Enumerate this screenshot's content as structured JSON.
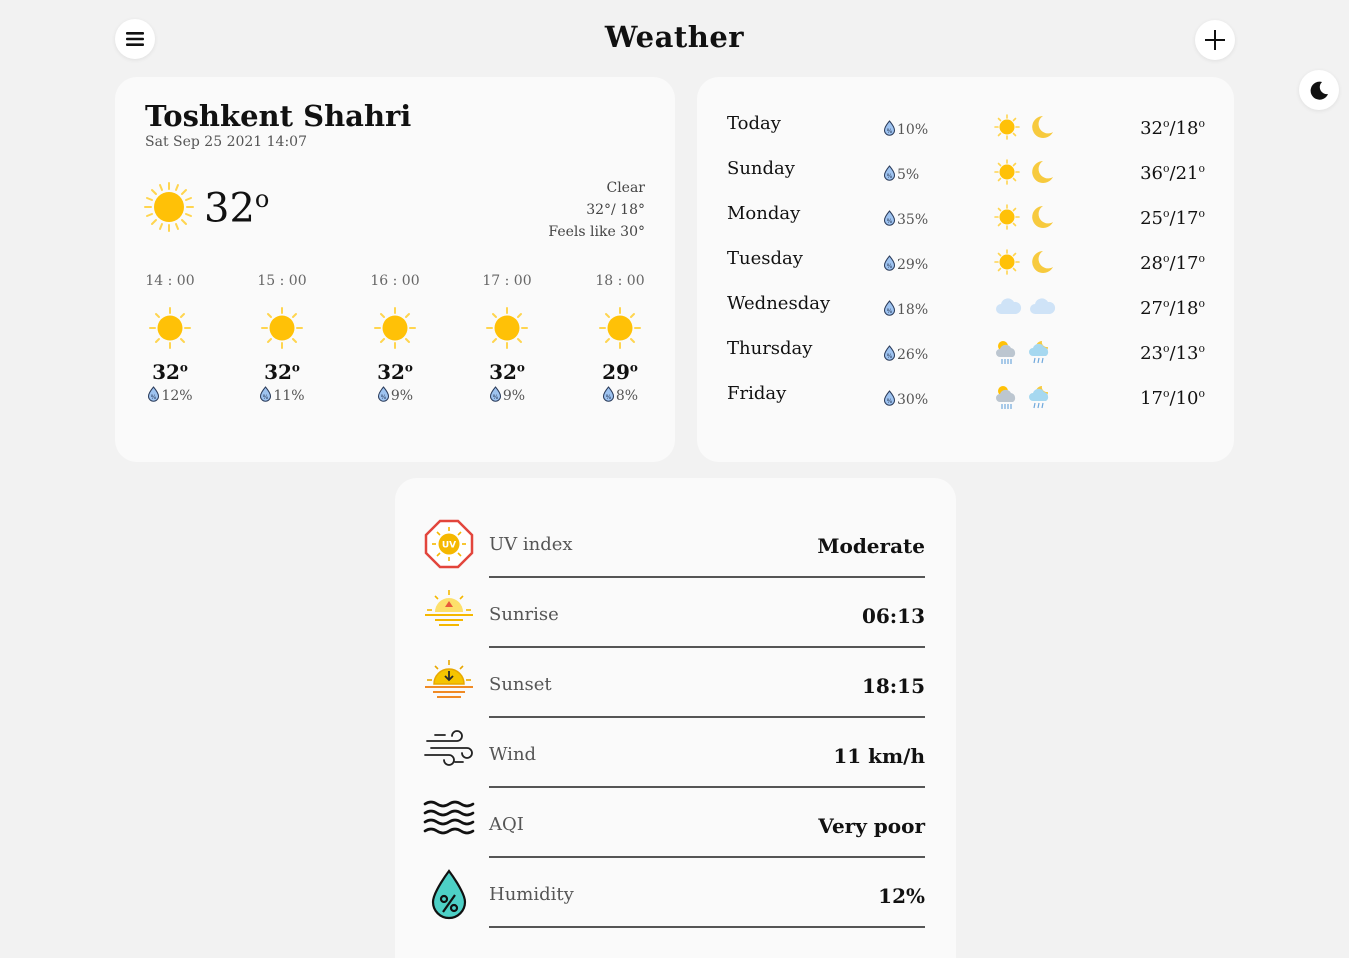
{
  "app": {
    "title": "Weather"
  },
  "current": {
    "city": "Toshkent Shahri",
    "datetime": "Sat Sep 25 2021 14:07",
    "temp": "32",
    "degree": "o",
    "condition": "Clear",
    "hi_lo": "32°/ 18°",
    "feels_like": "Feels like 30°"
  },
  "hourly": [
    {
      "time": "14 : 00",
      "temp": "32",
      "precip": "12%"
    },
    {
      "time": "15 : 00",
      "temp": "32",
      "precip": "11%"
    },
    {
      "time": "16 : 00",
      "temp": "32",
      "precip": "9%"
    },
    {
      "time": "17 : 00",
      "temp": "32",
      "precip": "9%"
    },
    {
      "time": "18 : 00",
      "temp": "29",
      "precip": "8%"
    }
  ],
  "daily": [
    {
      "day": "Today",
      "precip": "10%",
      "hi": "32",
      "lo": "18",
      "day_icon": "sun-icon",
      "night_icon": "moon-icon"
    },
    {
      "day": "Sunday",
      "precip": "5%",
      "hi": "36",
      "lo": "21",
      "day_icon": "sun-icon",
      "night_icon": "moon-icon"
    },
    {
      "day": "Monday",
      "precip": "35%",
      "hi": "25",
      "lo": "17",
      "day_icon": "sun-icon",
      "night_icon": "moon-icon"
    },
    {
      "day": "Tuesday",
      "precip": "29%",
      "hi": "28",
      "lo": "17",
      "day_icon": "sun-icon",
      "night_icon": "moon-icon"
    },
    {
      "day": "Wednesday",
      "precip": "18%",
      "hi": "27",
      "lo": "18",
      "day_icon": "cloud-icon",
      "night_icon": "cloud-icon"
    },
    {
      "day": "Thursday",
      "precip": "26%",
      "hi": "23",
      "lo": "13",
      "day_icon": "rain-cloud-icon",
      "night_icon": "night-rain-icon"
    },
    {
      "day": "Friday",
      "precip": "30%",
      "hi": "17",
      "lo": "10",
      "day_icon": "rain-cloud-icon",
      "night_icon": "night-rain-icon"
    }
  ],
  "details": [
    {
      "label": "UV index",
      "value": "Moderate",
      "icon": "uv-index-icon"
    },
    {
      "label": "Sunrise",
      "value": "06:13",
      "icon": "sunrise-icon"
    },
    {
      "label": "Sunset",
      "value": "18:15",
      "icon": "sunset-icon"
    },
    {
      "label": "Wind",
      "value": "11 km/h",
      "icon": "wind-icon"
    },
    {
      "label": "AQI",
      "value": "Very poor",
      "icon": "aqi-icon"
    },
    {
      "label": "Humidity",
      "value": "12%",
      "icon": "humidity-icon"
    }
  ],
  "colors": {
    "background": "#f2f2f2",
    "card": "#fafafa",
    "sun": "#ffc107",
    "moon": "#f7ca3e",
    "drop": "#5b8fd9"
  }
}
